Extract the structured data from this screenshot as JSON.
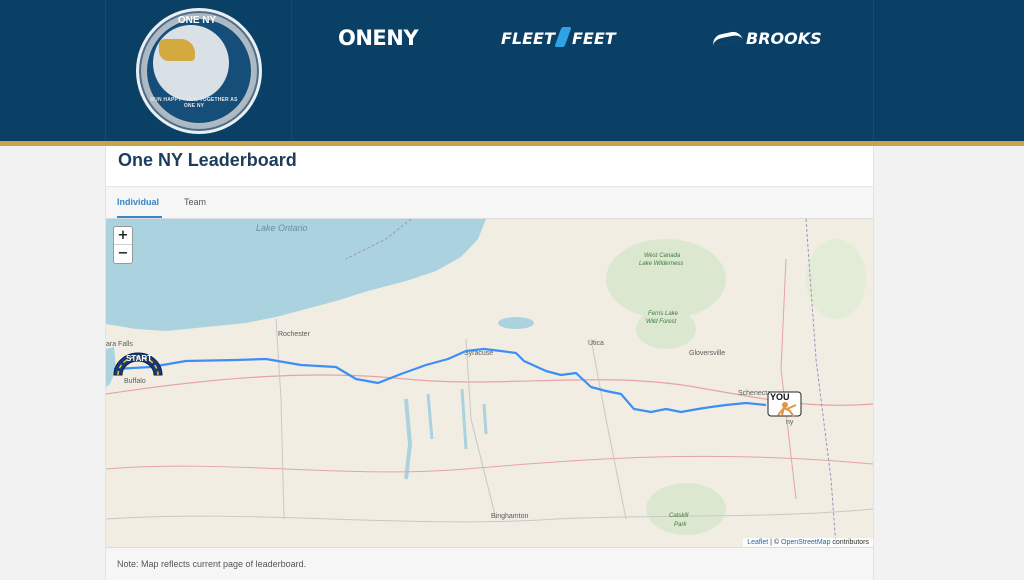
{
  "header": {
    "badge": {
      "top_text": "ONE NY",
      "bottom_text": "RUN HAPPY - RUN TOGETHER AS ONE NY"
    },
    "sponsors": {
      "oneny": "ONENY",
      "fleet": "FLEET",
      "feet": "FEET",
      "brooks": "BROOKS"
    }
  },
  "page": {
    "title": "One NY Leaderboard"
  },
  "tabs": {
    "individual": "Individual",
    "team": "Team",
    "active": "Individual"
  },
  "map": {
    "zoom_in": "+",
    "zoom_out": "−",
    "labels": {
      "lake_ontario": "Lake Ontario",
      "west_canada": "West Canada",
      "lake_wilderness": "Lake Wilderness",
      "ferris_lake": "Ferris Lake",
      "wild_forest": "Wild Forest",
      "rochester": "Rochester",
      "syracuse": "Syracuse",
      "utica": "Utica",
      "gloversville": "Gloversville",
      "schenectady": "Schenecta",
      "albany": "ny",
      "buffalo": "Buffalo",
      "niagara_falls": "ara Falls",
      "binghamton": "Binghamton",
      "catskill": "Catskill",
      "park": "Park"
    },
    "markers": {
      "start": "START",
      "you": "YOU"
    },
    "attribution": {
      "leaflet": "Leaflet",
      "separator": " | © ",
      "osm": "OpenStreetMap",
      "contributors": " contributors"
    },
    "route_color": "#3d8ef5"
  },
  "note": "Note: Map reflects current page of leaderboard."
}
